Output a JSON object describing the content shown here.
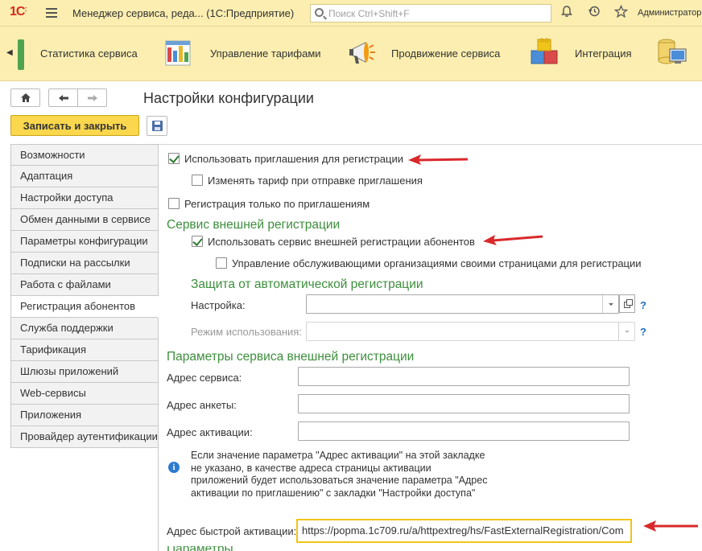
{
  "titlebar": {
    "logo": "1С",
    "app_title": "Менеджер сервиса, реда... (1С:Предприятие)",
    "search_placeholder": "Поиск Ctrl+Shift+F",
    "user": "Администратор"
  },
  "sections": [
    {
      "label": "Статистика сервиса",
      "icon": "statistics-icon"
    },
    {
      "label": "Управление тарифами",
      "icon": "tariffs-icon"
    },
    {
      "label": "Продвижение сервиса",
      "icon": "megaphone-icon"
    },
    {
      "label": "Интеграция",
      "icon": "integration-blocks-icon"
    },
    {
      "label": "",
      "icon": "database-computer-icon"
    }
  ],
  "page": {
    "title": "Настройки конфигурации",
    "save_close_label": "Записать и закрыть"
  },
  "nav_items": [
    "Возможности",
    "Адаптация",
    "Настройки доступа",
    "Обмен данными в сервисе",
    "Параметры конфигурации",
    "Подписки на рассылки",
    "Работа с файлами",
    "Регистрация абонентов",
    "Служба поддержки",
    "Тарификация",
    "Шлюзы приложений",
    "Web-сервисы",
    "Приложения",
    "Провайдер аутентификации"
  ],
  "active_nav": "Регистрация абонентов",
  "content": {
    "use_invitations": {
      "label": "Использовать приглашения для регистрации",
      "checked": true
    },
    "change_tariff": {
      "label": "Изменять тариф при отправке приглашения",
      "checked": false
    },
    "only_invitations": {
      "label": "Регистрация только по приглашениям",
      "checked": false
    },
    "ext_group_title": "Сервис внешней регистрации",
    "use_ext_service": {
      "label": "Использовать сервис внешней регистрации абонентов",
      "checked": true
    },
    "manage_orgs": {
      "label": "Управление обслуживающими организациями своими страницами для регистрации",
      "checked": false
    },
    "protection_title": "Защита от автоматической регистрации",
    "setting_label": "Настройка:",
    "setting_value": "",
    "mode_label": "Режим использования:",
    "mode_value": "",
    "help_mark": "?",
    "params_title": "Параметры сервиса внешней регистрации",
    "service_address_label": "Адрес сервиса:",
    "service_address_value": "",
    "form_address_label": "Адрес анкеты:",
    "form_address_value": "",
    "activation_address_label": "Адрес активации:",
    "activation_address_value": "",
    "info_text": "Если значение параметра \"Адрес активации\" на этой закладке не указано, в качестве адреса страницы активации приложений будет использоваться значение параметра \"Адрес активации по приглашению\" с закладки \"Настройки доступа\"",
    "fast_activation_label": "Адрес быстрой активации:",
    "fast_activation_value": "https://popma.1c709.ru/a/httpextreg/hs/FastExternalRegistration/Com"
  },
  "colors": {
    "accent_yellow": "#fad74d",
    "header_bg": "#fbeeb0",
    "group_green": "#3d8f3d",
    "arrow_red": "#d9292c",
    "link_blue": "#1f6fc1"
  }
}
